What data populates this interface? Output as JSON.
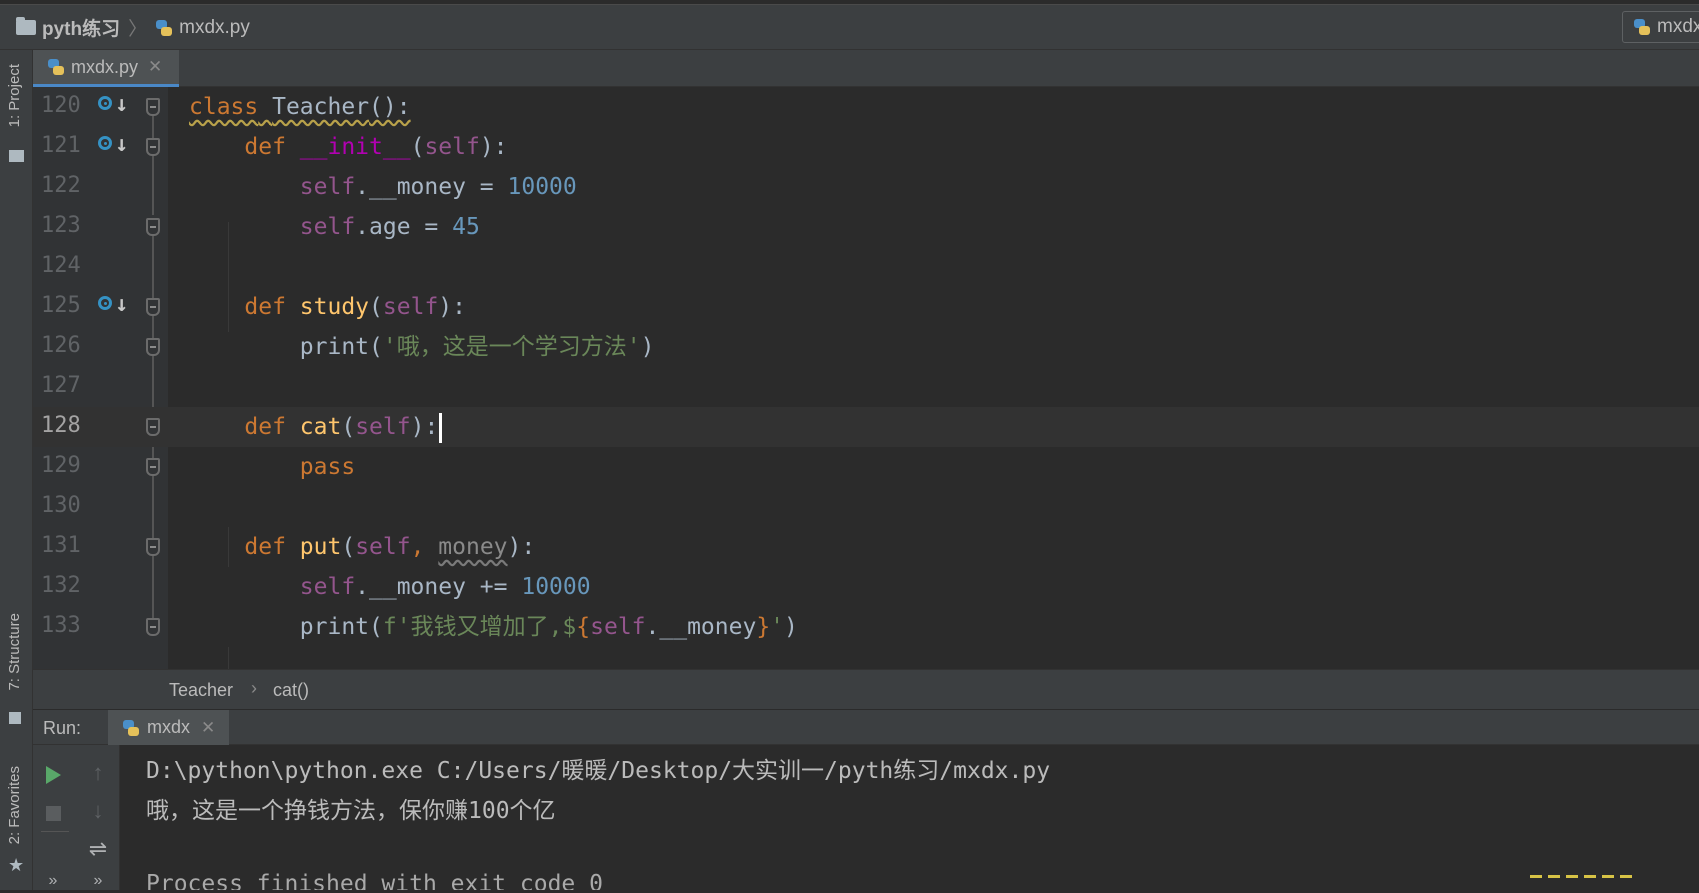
{
  "navbar": {
    "project_name": "pyth练习",
    "file_name": "mxdx.py",
    "run_config": "mxdx"
  },
  "left_tools": {
    "project": "1: Project",
    "structure": "7: Structure",
    "favorites": "2: Favorites"
  },
  "editor_tabs": [
    {
      "label": "mxdx.py",
      "active": true
    }
  ],
  "editor": {
    "current_line": "128",
    "line_numbers": [
      "120",
      "121",
      "122",
      "123",
      "124",
      "125",
      "126",
      "127",
      "128",
      "129",
      "130",
      "131",
      "132",
      "133"
    ],
    "code": {
      "l120": {
        "kw": "class",
        "name": "Teacher",
        "rest": "():"
      },
      "l121": {
        "kw": "def",
        "name": "__init__",
        "open": "(",
        "self": "self",
        "close": "):"
      },
      "l122": {
        "self": "self",
        "attr": ".__money = ",
        "num": "10000"
      },
      "l123": {
        "self": "self",
        "attr": ".age = ",
        "num": "45"
      },
      "l125": {
        "kw": "def",
        "name": "study",
        "open": "(",
        "self": "self",
        "close": "):"
      },
      "l126": {
        "fn": "print",
        "open": "(",
        "str": "'哦，这是一个学习方法'",
        "close": ")"
      },
      "l128": {
        "kw": "def",
        "name": "cat",
        "open": "(",
        "self": "self",
        "close": "):"
      },
      "l129": {
        "kw": "pass"
      },
      "l131": {
        "kw": "def",
        "name": "put",
        "open": "(",
        "self": "self",
        "comma": ", ",
        "param": "money",
        "close": "):"
      },
      "l132": {
        "self": "self",
        "attr": ".__money += ",
        "num": "10000"
      },
      "l133": {
        "fn": "print",
        "open": "(",
        "str1": "f'我钱又增加了,$",
        "brace1": "{",
        "self": "self",
        "attr": ".__money",
        "brace2": "}",
        "str2": "'",
        "close": ")"
      }
    }
  },
  "breadcrumb": {
    "class_name": "Teacher",
    "method_name": "cat()"
  },
  "run": {
    "label": "Run:",
    "tab": "mxdx",
    "console": [
      "D:\\python\\python.exe C:/Users/暖暖/Desktop/大实训一/pyth练习/mxdx.py",
      "哦，这是一个挣钱方法，保你赚100个亿",
      "",
      "Process finished with exit code 0"
    ]
  },
  "icons": [
    "folder-icon",
    "python-file-icon",
    "override-marker-icon",
    "fold-icon",
    "play-icon",
    "stop-icon",
    "up-arrow-icon",
    "down-arrow-icon",
    "soft-wrap-icon",
    "more-icon",
    "close-icon"
  ],
  "colors": {
    "keyword": "#cc7832",
    "function": "#ffc66d",
    "self": "#94558d",
    "number": "#6897bb",
    "string": "#6a8759",
    "run_green": "#59a869"
  }
}
